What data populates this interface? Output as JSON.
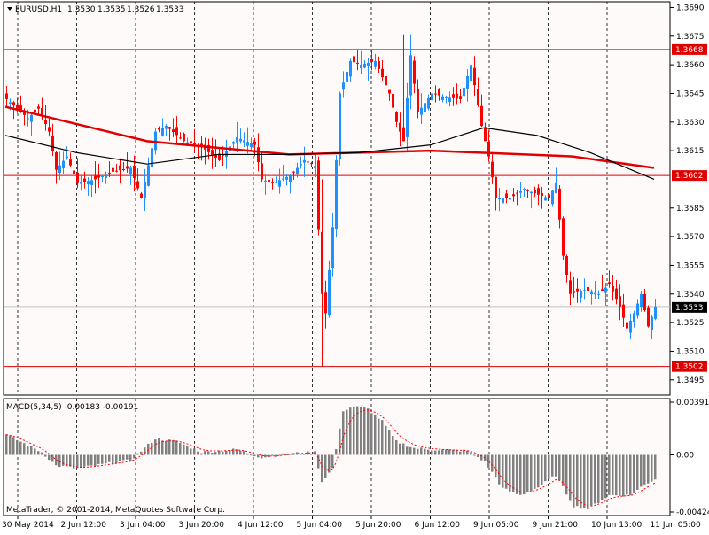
{
  "header": {
    "symbol_timeframe": "EURUSD,H1",
    "open": "1.3530",
    "high": "1.3535",
    "low": "1.3526",
    "close": "1.3533"
  },
  "macd_label": "MACD(5,34,5) -0.00183 -0.00191",
  "copyright": "MetaTrader, © 2001-2014, MetaQuotes Software Corp.",
  "colors": {
    "background": "#FFFAFA",
    "up_candle": "#1E90FF",
    "down_candle": "#FF0000",
    "ma_red": "#E00000",
    "ma_black": "#000000",
    "level_line": "#E00000",
    "price_line": "#C0C0C0",
    "macd_hist": "#808080",
    "macd_signal": "#FF0000"
  },
  "price_axis": {
    "min": 1.3487,
    "max": 1.3693,
    "ticks": [
      "1.3690",
      "1.3675",
      "1.3660",
      "1.3645",
      "1.3630",
      "1.3615",
      "1.3585",
      "1.3570",
      "1.3555",
      "1.3540",
      "1.3525",
      "1.3510",
      "1.3495"
    ]
  },
  "levels": [
    {
      "value": 1.3668,
      "label": "1.3668",
      "color": "#E00000"
    },
    {
      "value": 1.3602,
      "label": "1.3602",
      "color": "#E00000"
    },
    {
      "value": 1.3502,
      "label": "1.3502",
      "color": "#E00000"
    },
    {
      "value": 1.3533,
      "label": "1.3533",
      "color": "#000000",
      "current": true
    }
  ],
  "time_labels": [
    "30 May 2014",
    "2 Jun 12:00",
    "3 Jun 04:00",
    "3 Jun 20:00",
    "4 Jun 12:00",
    "5 Jun 04:00",
    "5 Jun 20:00",
    "6 Jun 12:00",
    "9 Jun 05:00",
    "9 Jun 21:00",
    "10 Jun 13:00",
    "11 Jun 05:00"
  ],
  "macd_axis": {
    "min": -0.00424,
    "max": 0.00391,
    "ticks": [
      "0.00391",
      "0.00",
      "-0.00424"
    ]
  },
  "chart_data": {
    "type": "candlestick",
    "title": "EURUSD,H1",
    "ylim": [
      1.3487,
      1.3693
    ],
    "x_labels": [
      "30 May 2014",
      "2 Jun 12:00",
      "3 Jun 04:00",
      "3 Jun 20:00",
      "4 Jun 12:00",
      "5 Jun 04:00",
      "5 Jun 20:00",
      "6 Jun 12:00",
      "9 Jun 05:00",
      "9 Jun 21:00",
      "10 Jun 13:00",
      "11 Jun 05:00"
    ],
    "anchors": [
      {
        "i": 0,
        "c": 1.3642
      },
      {
        "i": 6,
        "c": 1.3632
      },
      {
        "i": 9,
        "c": 1.3637
      },
      {
        "i": 12,
        "c": 1.3625
      },
      {
        "i": 14,
        "c": 1.3605
      },
      {
        "i": 17,
        "c": 1.3612
      },
      {
        "i": 20,
        "c": 1.3598
      },
      {
        "i": 25,
        "c": 1.36
      },
      {
        "i": 30,
        "c": 1.3604
      },
      {
        "i": 35,
        "c": 1.3606
      },
      {
        "i": 38,
        "c": 1.359
      },
      {
        "i": 42,
        "c": 1.3625
      },
      {
        "i": 45,
        "c": 1.3628
      },
      {
        "i": 50,
        "c": 1.362
      },
      {
        "i": 55,
        "c": 1.3617
      },
      {
        "i": 60,
        "c": 1.361
      },
      {
        "i": 65,
        "c": 1.3622
      },
      {
        "i": 70,
        "c": 1.3618
      },
      {
        "i": 72,
        "c": 1.36
      },
      {
        "i": 75,
        "c": 1.3598
      },
      {
        "i": 80,
        "c": 1.3602
      },
      {
        "i": 84,
        "c": 1.361
      },
      {
        "i": 87,
        "c": 1.3607
      },
      {
        "i": 89,
        "c": 1.354
      },
      {
        "i": 90,
        "c": 1.353
      },
      {
        "i": 92,
        "c": 1.3575
      },
      {
        "i": 94,
        "c": 1.3645
      },
      {
        "i": 97,
        "c": 1.3662
      },
      {
        "i": 100,
        "c": 1.366
      },
      {
        "i": 104,
        "c": 1.3662
      },
      {
        "i": 108,
        "c": 1.3645
      },
      {
        "i": 110,
        "c": 1.363
      },
      {
        "i": 112,
        "c": 1.362
      },
      {
        "i": 114,
        "c": 1.3665
      },
      {
        "i": 116,
        "c": 1.3635
      },
      {
        "i": 120,
        "c": 1.3645
      },
      {
        "i": 124,
        "c": 1.3643
      },
      {
        "i": 128,
        "c": 1.3642
      },
      {
        "i": 131,
        "c": 1.366
      },
      {
        "i": 134,
        "c": 1.3628
      },
      {
        "i": 136,
        "c": 1.3612
      },
      {
        "i": 138,
        "c": 1.359
      },
      {
        "i": 142,
        "c": 1.359
      },
      {
        "i": 146,
        "c": 1.3595
      },
      {
        "i": 150,
        "c": 1.3592
      },
      {
        "i": 153,
        "c": 1.359
      },
      {
        "i": 155,
        "c": 1.3598
      },
      {
        "i": 157,
        "c": 1.356
      },
      {
        "i": 159,
        "c": 1.354
      },
      {
        "i": 163,
        "c": 1.3542
      },
      {
        "i": 167,
        "c": 1.354
      },
      {
        "i": 170,
        "c": 1.3545
      },
      {
        "i": 173,
        "c": 1.3533
      },
      {
        "i": 175,
        "c": 1.3522
      },
      {
        "i": 177,
        "c": 1.353
      },
      {
        "i": 179,
        "c": 1.354
      },
      {
        "i": 181,
        "c": 1.3523
      },
      {
        "i": 183,
        "c": 1.3533
      }
    ],
    "moving_averages": [
      {
        "color": "red",
        "points": [
          [
            0,
            1.3638
          ],
          [
            40,
            1.362
          ],
          [
            80,
            1.3613
          ],
          [
            120,
            1.3615
          ],
          [
            160,
            1.3612
          ],
          [
            183,
            1.3606
          ]
        ]
      },
      {
        "color": "black",
        "points": [
          [
            0,
            1.3623
          ],
          [
            20,
            1.3614
          ],
          [
            40,
            1.3608
          ],
          [
            60,
            1.3613
          ],
          [
            80,
            1.3613
          ],
          [
            100,
            1.3614
          ],
          [
            120,
            1.3618
          ],
          [
            135,
            1.3627
          ],
          [
            150,
            1.3623
          ],
          [
            165,
            1.3614
          ],
          [
            183,
            1.36
          ]
        ]
      }
    ],
    "macd": {
      "name": "MACD(5,34,5)",
      "main": -0.00183,
      "signal": -0.00191,
      "ylim": [
        -0.00424,
        0.00391
      ],
      "anchors": [
        {
          "i": 0,
          "v": 0.0015
        },
        {
          "i": 10,
          "v": 0.0002
        },
        {
          "i": 14,
          "v": -0.0008
        },
        {
          "i": 20,
          "v": -0.001
        },
        {
          "i": 35,
          "v": -0.0004
        },
        {
          "i": 42,
          "v": 0.0012
        },
        {
          "i": 48,
          "v": 0.001
        },
        {
          "i": 55,
          "v": 0.0002
        },
        {
          "i": 65,
          "v": 0.0004
        },
        {
          "i": 72,
          "v": -0.0002
        },
        {
          "i": 80,
          "v": 0.0001
        },
        {
          "i": 87,
          "v": 0.0002
        },
        {
          "i": 89,
          "v": -0.002
        },
        {
          "i": 92,
          "v": -0.001
        },
        {
          "i": 95,
          "v": 0.0033
        },
        {
          "i": 98,
          "v": 0.0036
        },
        {
          "i": 102,
          "v": 0.0034
        },
        {
          "i": 106,
          "v": 0.0025
        },
        {
          "i": 110,
          "v": 0.001
        },
        {
          "i": 115,
          "v": 0.0005
        },
        {
          "i": 120,
          "v": 0.0004
        },
        {
          "i": 130,
          "v": 0.0003
        },
        {
          "i": 135,
          "v": -0.0005
        },
        {
          "i": 140,
          "v": -0.0025
        },
        {
          "i": 145,
          "v": -0.003
        },
        {
          "i": 150,
          "v": -0.0024
        },
        {
          "i": 155,
          "v": -0.0015
        },
        {
          "i": 160,
          "v": -0.0038
        },
        {
          "i": 164,
          "v": -0.004
        },
        {
          "i": 170,
          "v": -0.003
        },
        {
          "i": 176,
          "v": -0.003
        },
        {
          "i": 180,
          "v": -0.0022
        },
        {
          "i": 183,
          "v": -0.0018
        }
      ]
    }
  }
}
